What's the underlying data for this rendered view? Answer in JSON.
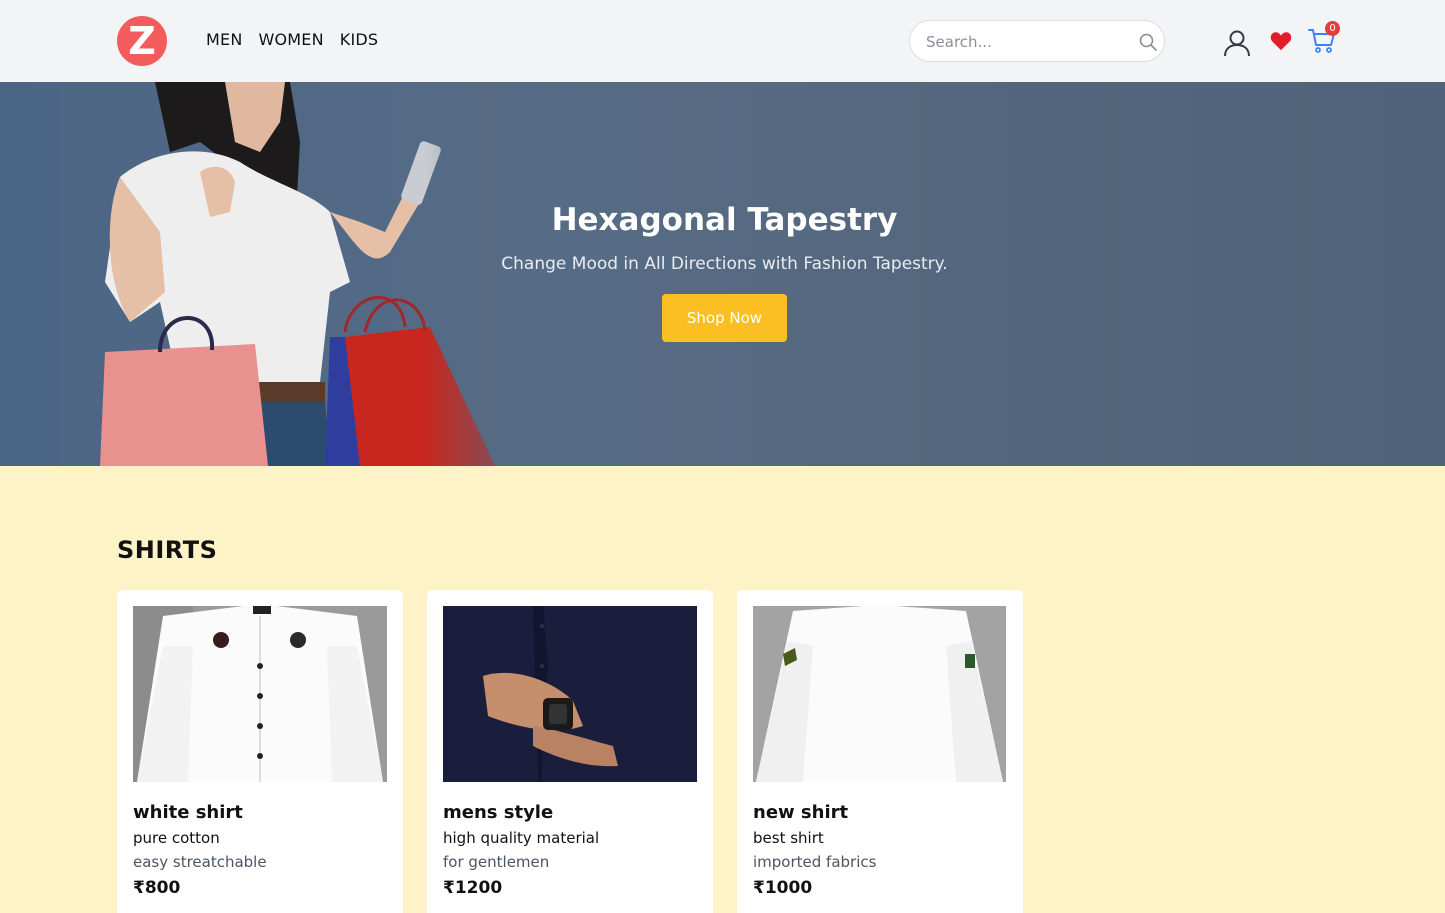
{
  "header": {
    "logo_letter": "Z",
    "nav": [
      "MEN",
      "WOMEN",
      "KIDS"
    ],
    "search_placeholder": "Search...",
    "cart_count": "0"
  },
  "hero": {
    "title": "Hexagonal Tapestry",
    "subtitle": "Change Mood in All Directions with Fashion Tapestry.",
    "button_label": "Shop Now"
  },
  "section": {
    "title": "SHIRTS"
  },
  "products": [
    {
      "name": "white shirt",
      "desc": "pure cotton",
      "sub": "easy streatchable",
      "price": "₹800"
    },
    {
      "name": "mens style",
      "desc": "high quality material",
      "sub": "for gentlemen",
      "price": "₹1200"
    },
    {
      "name": "new shirt",
      "desc": "best shirt",
      "sub": "imported fabrics",
      "price": "₹1000"
    }
  ],
  "colors": {
    "accent": "#fbbf24",
    "logo": "#f25c5c",
    "badge": "#e63b3b",
    "heart": "#e11d2a",
    "cart": "#3b82f6"
  }
}
